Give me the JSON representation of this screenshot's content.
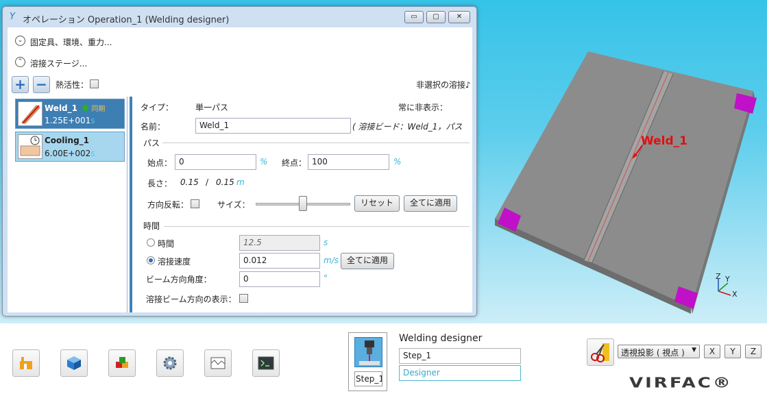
{
  "window": {
    "title": "オペレーション Operation_1 (Welding designer)",
    "minimize": "▭",
    "restore": "▢",
    "close": "✕"
  },
  "sections": {
    "fixtures": "固定具、環境、重力...",
    "weld_stage": "溶接ステージ..."
  },
  "stage_toolbar": {
    "add": "+",
    "remove": "−",
    "thermal_label": "熱活性：",
    "unselected_label": "非選択の溶接♪"
  },
  "list": {
    "items": [
      {
        "name": "Weld_1",
        "tag": "同期",
        "value": "1.25E+001",
        "unit": "s"
      },
      {
        "name": "Cooling_1",
        "value": "6.00E+002",
        "unit": "s"
      }
    ]
  },
  "form": {
    "type_label": "タイプ：",
    "type_value": "単一パス",
    "always_hide_label": "常に非表示：",
    "name_label": "名前：",
    "name_value": "Weld_1",
    "bead_info": "( 溶接ビード：Weld_1，パス",
    "pass_section": "パス",
    "start_label": "始点：",
    "start_value": "0",
    "start_unit": "%",
    "end_label": "終点：",
    "end_value": "100",
    "end_unit": "%",
    "length_label": "長さ：",
    "length_value": "0.15",
    "length_sep": "/",
    "length_total": "0.15",
    "length_unit": "m",
    "reverse_label": "方向反転：",
    "size_label": "サイズ：",
    "reset_button": "リセット",
    "apply_all_button": "全てに適用",
    "time_section": "時間",
    "time_label": "時間",
    "time_value": "12.5",
    "time_unit": "s",
    "speed_label": "溶接速度",
    "speed_value": "0.012",
    "speed_unit": "m/s",
    "speed_apply_button": "全てに適用",
    "beam_angle_label": "ビーム方向角度：",
    "beam_angle_value": "0",
    "beam_angle_unit": "°",
    "beam_show_label": "溶接ビーム方向の表示："
  },
  "viewport": {
    "weld_label": "Weld_1",
    "axis_x": "X",
    "axis_y": "Y",
    "axis_z": "Z"
  },
  "bottom": {
    "tool_icons": [
      "factory-icon",
      "cube-icon",
      "parts-icon",
      "gear-icon",
      "mesh-icon",
      "terminal-icon"
    ],
    "step_name": "Step_1",
    "designer_title": "Welding designer",
    "step_field": "Step_1",
    "designer_field": "Designer",
    "projection": "透視投影 ( 視点 )",
    "view_x": "X",
    "view_y": "Y",
    "view_z": "Z",
    "logo": "VIRFAC®"
  },
  "colors": {
    "accent": "#3d7eb3",
    "list_cool": "#a6d7ee",
    "unit_color": "#3ab4d6",
    "sky": "#35c3e8",
    "fixture": "#c010c8",
    "plate": "#8a8a8a"
  }
}
